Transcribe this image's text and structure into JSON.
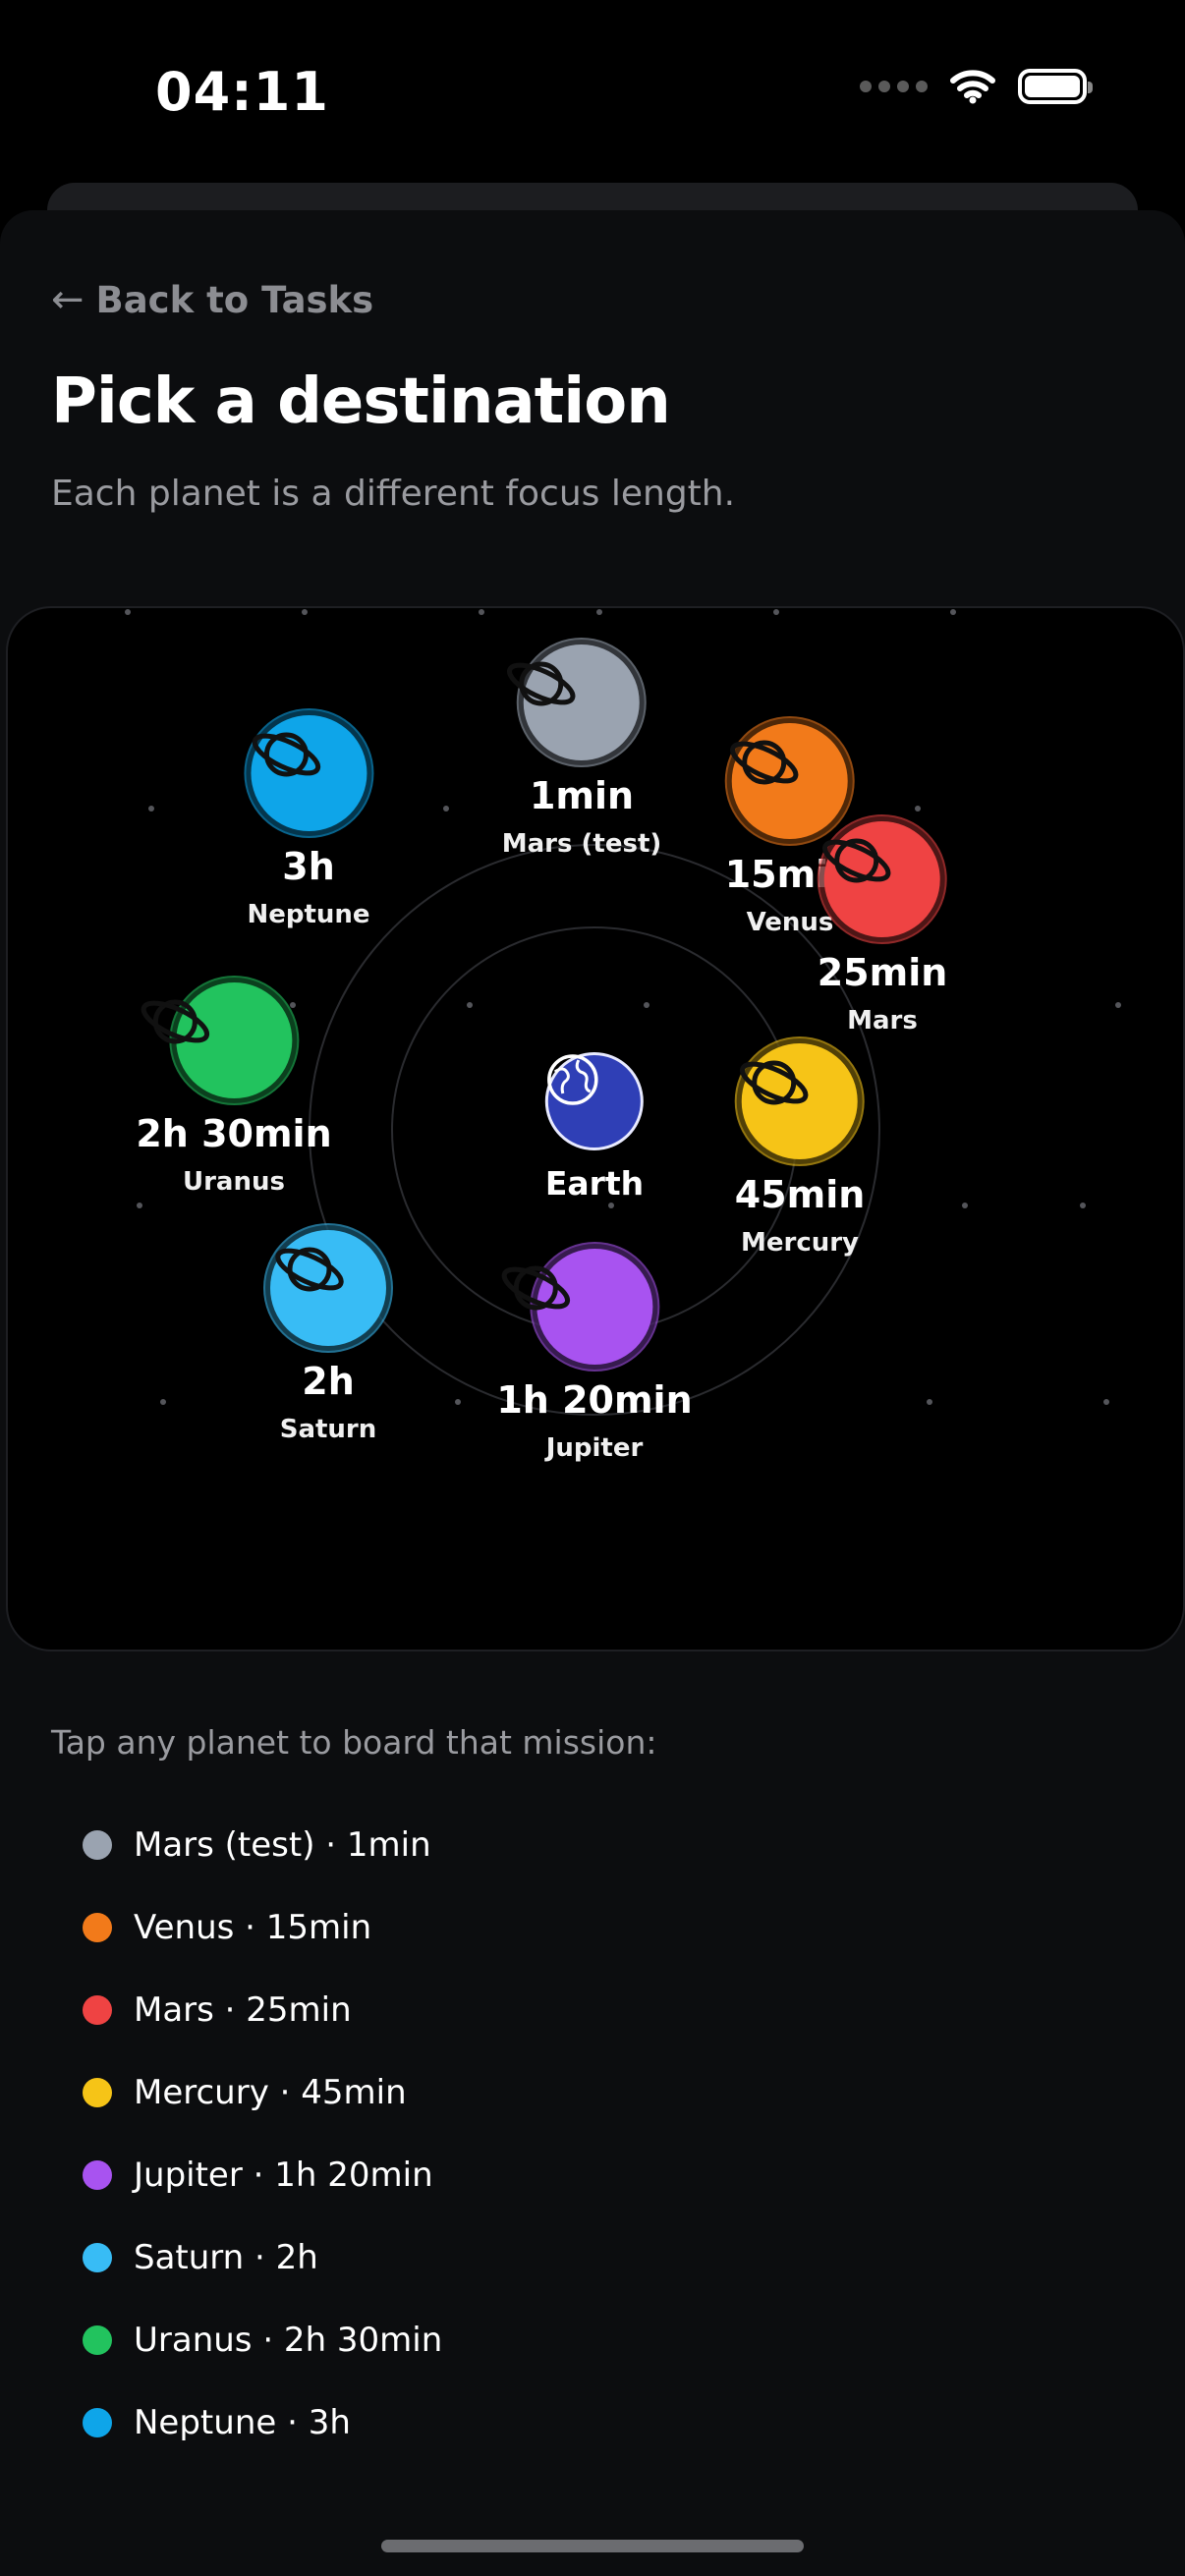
{
  "status_bar": {
    "time": "04:11"
  },
  "header": {
    "back_label": "Back to Tasks",
    "title": "Pick a destination",
    "subtitle": "Each planet is a different focus length."
  },
  "center": {
    "name": "Earth",
    "icon": "globe-icon",
    "color": "#2f3fb6"
  },
  "planets": [
    {
      "duration": "1min",
      "name": "Mars (test)",
      "color": "#9aa3b0",
      "icon": "planet-icon"
    },
    {
      "duration": "15min",
      "name": "Venus",
      "color": "#f27a1a",
      "icon": "planet-icon"
    },
    {
      "duration": "25min",
      "name": "Mars",
      "color": "#ef4343",
      "icon": "planet-icon"
    },
    {
      "duration": "45min",
      "name": "Mercury",
      "color": "#f6c417",
      "icon": "planet-icon"
    },
    {
      "duration": "1h 20min",
      "name": "Jupiter",
      "color": "#a853f0",
      "icon": "planet-icon"
    },
    {
      "duration": "2h",
      "name": "Saturn",
      "color": "#38bcf5",
      "icon": "planet-icon"
    },
    {
      "duration": "2h 30min",
      "name": "Uranus",
      "color": "#22c35e",
      "icon": "planet-icon"
    },
    {
      "duration": "3h",
      "name": "Neptune",
      "color": "#0ea5e9",
      "icon": "planet-icon"
    }
  ],
  "legend": {
    "intro": "Tap any planet to board that mission:",
    "items": [
      {
        "label": "Mars (test) · 1min",
        "color": "#9aa3b0"
      },
      {
        "label": "Venus · 15min",
        "color": "#f27a1a"
      },
      {
        "label": "Mars · 25min",
        "color": "#ef4343"
      },
      {
        "label": "Mercury · 45min",
        "color": "#f6c417"
      },
      {
        "label": "Jupiter · 1h 20min",
        "color": "#a853f0"
      },
      {
        "label": "Saturn · 2h",
        "color": "#38bcf5"
      },
      {
        "label": "Uranus · 2h 30min",
        "color": "#22c35e"
      },
      {
        "label": "Neptune · 3h",
        "color": "#0ea5e9"
      }
    ]
  }
}
